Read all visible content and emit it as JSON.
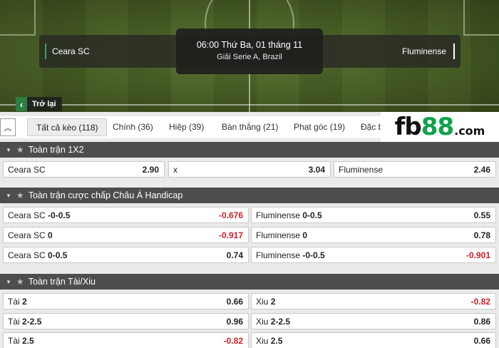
{
  "match": {
    "home_team": "Ceara SC",
    "away_team": "Fluminense",
    "datetime": "06:00 Thứ Ba, 01 tháng 11",
    "league": "Giải Serie A, Brazil"
  },
  "back_label": "Trở lại",
  "logo": {
    "part1": "fb",
    "part2": "88",
    "part3": ".com"
  },
  "tabs": [
    {
      "label": "Tất cả kèo (118)"
    },
    {
      "label": "Chính (36)"
    },
    {
      "label": "Hiệp (39)"
    },
    {
      "label": "Bàn thắng (21)"
    },
    {
      "label": "Phạt góc (19)"
    },
    {
      "label": "Đặc b"
    }
  ],
  "sections": {
    "s1x2": {
      "title": "Toàn trận 1X2",
      "cells": [
        {
          "label": "Ceara SC",
          "odd": "2.90"
        },
        {
          "label": "x",
          "odd": "3.04"
        },
        {
          "label": "Fluminense",
          "odd": "2.46"
        }
      ]
    },
    "handicap": {
      "title": "Toàn trận cược chấp Châu Á Handicap",
      "rows": [
        [
          {
            "team": "Ceara SC",
            "line": "-0-0.5",
            "odd": "-0.676"
          },
          {
            "team": "Fluminense",
            "line": "0-0.5",
            "odd": "0.55"
          }
        ],
        [
          {
            "team": "Ceara SC",
            "line": "0",
            "odd": "-0.917"
          },
          {
            "team": "Fluminense",
            "line": "0",
            "odd": "0.78"
          }
        ],
        [
          {
            "team": "Ceara SC",
            "line": "0-0.5",
            "odd": "0.74"
          },
          {
            "team": "Fluminense",
            "line": "-0-0.5",
            "odd": "-0.901"
          }
        ]
      ]
    },
    "totals": {
      "title": "Toàn trận Tài/Xiu",
      "rows": [
        [
          {
            "team": "Tài",
            "line": "2",
            "odd": "0.66"
          },
          {
            "team": "Xiu",
            "line": "2",
            "odd": "-0.82"
          }
        ],
        [
          {
            "team": "Tài",
            "line": "2-2.5",
            "odd": "0.96"
          },
          {
            "team": "Xiu",
            "line": "2-2.5",
            "odd": "0.86"
          }
        ],
        [
          {
            "team": "Tài",
            "line": "2.5",
            "odd": "-0.82"
          },
          {
            "team": "Xiu",
            "line": "2.5",
            "odd": "0.66"
          }
        ]
      ]
    }
  },
  "colors": {
    "negative_odd": "#d0202a",
    "accent_green": "#2d7d45",
    "section_header": "#4d4d4d"
  },
  "icons": {
    "back": "chevron-left-icon",
    "collapse": "double-chevron-up-icon",
    "section_toggle": "triangle-down-icon",
    "favorite": "star-icon"
  }
}
